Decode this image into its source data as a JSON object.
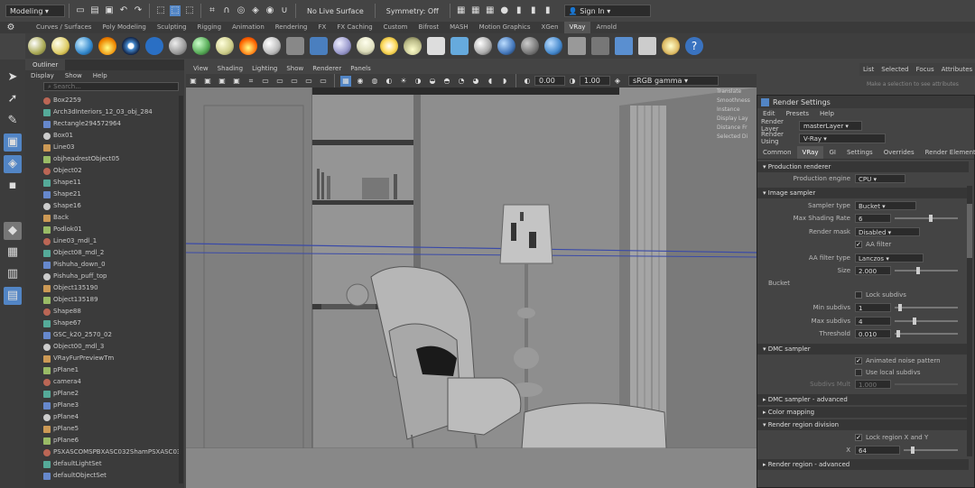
{
  "statusline": {
    "mode": "Modeling",
    "live_surface": "No Live Surface",
    "symmetry": "Symmetry: Off",
    "signin": "Sign In"
  },
  "shelf_tabs": [
    "Curves / Surfaces",
    "Poly Modeling",
    "Sculpting",
    "Rigging",
    "Animation",
    "Rendering",
    "FX",
    "FX Caching",
    "Custom",
    "Bifrost",
    "MASH",
    "Motion Graphics",
    "XGen",
    "VRay",
    "Arnold"
  ],
  "shelf_active": "VRay",
  "outliner": {
    "title": "Outliner",
    "menu": [
      "Display",
      "Show",
      "Help"
    ],
    "search_placeholder": "Search...",
    "items": [
      "Box2259",
      "Arch3dInteriors_12_03_obj_284",
      "Rectangle294572964",
      "Box01",
      "Line03",
      "objheadrestObject05",
      "Object02",
      "Shape11",
      "Shape21",
      "Shape16",
      "Back",
      "Podlok01",
      "Line03_mdl_1",
      "Object08_mdl_2",
      "Pishuha_down_0",
      "Pishuha_puff_top",
      "Object135190",
      "Object135189",
      "Shape88",
      "Shape67",
      "GSC_k20_2570_02",
      "Object00_mdl_3",
      "VRayFurPreviewTm",
      "pPlane1",
      "camera4",
      "pPlane2",
      "pPlane3",
      "pPlane4",
      "pPlane5",
      "pPlane6",
      "PSXASCOMSPBXASC032ShamPSXASC03",
      "defaultLightSet",
      "defaultObjectSet"
    ]
  },
  "viewport": {
    "menu": [
      "View",
      "Shading",
      "Lighting",
      "Show",
      "Renderer",
      "Panels"
    ],
    "field_a": "0.00",
    "field_b": "1.00",
    "colorspace": "sRGB gamma"
  },
  "channelbox_labels": [
    "Translate",
    "Smoothness",
    "Instance",
    "Display Lay",
    "Distance Fr",
    "Selected Di"
  ],
  "attr_tabs": [
    "List",
    "Selected",
    "Focus",
    "Attributes"
  ],
  "attr_hint": "Make a selection to see attributes",
  "render_settings": {
    "title": "Render Settings",
    "menu": [
      "Edit",
      "Presets",
      "Help"
    ],
    "render_layer_label": "Render Layer",
    "render_layer": "masterLayer",
    "render_using_label": "Render Using",
    "render_using": "V-Ray",
    "tabs": [
      "Common",
      "VRay",
      "GI",
      "Settings",
      "Overrides",
      "Render Elements"
    ],
    "active_tab": "VRay",
    "sections": {
      "production": "Production renderer",
      "image_sampler": "Image sampler",
      "dmc": "DMC sampler",
      "dmc_adv": "DMC sampler - advanced",
      "color_mapping": "Color mapping",
      "render_region": "Render region division",
      "render_region_adv": "Render region - advanced"
    },
    "fields": {
      "production_engine_label": "Production engine",
      "production_engine": "CPU",
      "sampler_type_label": "Sampler type",
      "sampler_type": "Bucket",
      "max_shading_rate_label": "Max Shading Rate",
      "max_shading_rate": "6",
      "render_mask_label": "Render mask",
      "render_mask": "Disabled",
      "aa_filter_label": "AA filter",
      "aa_filter_type_label": "AA filter type",
      "aa_filter_type": "Lanczos",
      "size_label": "Size",
      "size": "2.000",
      "bucket_label": "Bucket",
      "lock_subdivs_label": "Lock subdivs",
      "min_subdivs_label": "Min subdivs",
      "min_subdivs": "1",
      "max_subdivs_label": "Max subdivs",
      "max_subdivs": "4",
      "threshold_label": "Threshold",
      "threshold": "0.010",
      "animated_noise_label": "Animated noise pattern",
      "use_local_subdivs_label": "Use local subdivs",
      "subdivs_mult_label": "Subdivs Mult",
      "subdivs_mult": "1.000",
      "lock_region_label": "Lock region X and Y",
      "x_label": "X",
      "x_value": "64"
    }
  },
  "colors": {
    "accent_blue": "#5285c5",
    "panel": "#444444",
    "dark": "#2b2b2b"
  }
}
